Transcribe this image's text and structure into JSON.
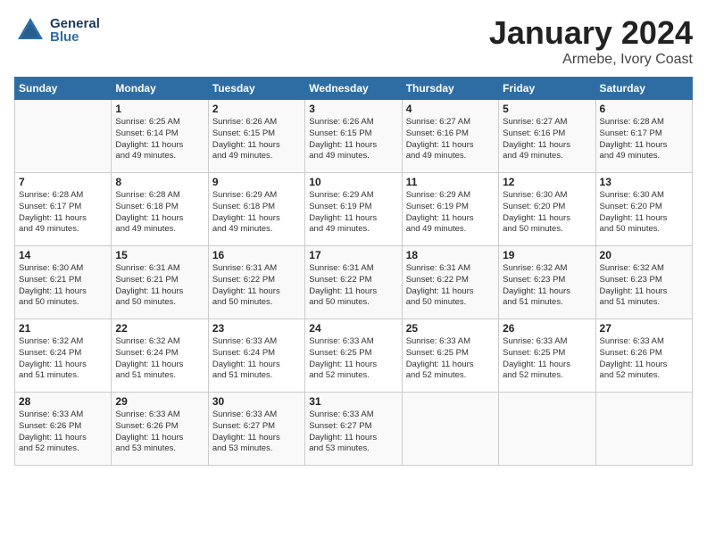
{
  "header": {
    "logo_general": "General",
    "logo_blue": "Blue",
    "month_title": "January 2024",
    "location": "Armebe, Ivory Coast"
  },
  "weekdays": [
    "Sunday",
    "Monday",
    "Tuesday",
    "Wednesday",
    "Thursday",
    "Friday",
    "Saturday"
  ],
  "weeks": [
    [
      {
        "day": "",
        "info": ""
      },
      {
        "day": "1",
        "info": "Sunrise: 6:25 AM\nSunset: 6:14 PM\nDaylight: 11 hours\nand 49 minutes."
      },
      {
        "day": "2",
        "info": "Sunrise: 6:26 AM\nSunset: 6:15 PM\nDaylight: 11 hours\nand 49 minutes."
      },
      {
        "day": "3",
        "info": "Sunrise: 6:26 AM\nSunset: 6:15 PM\nDaylight: 11 hours\nand 49 minutes."
      },
      {
        "day": "4",
        "info": "Sunrise: 6:27 AM\nSunset: 6:16 PM\nDaylight: 11 hours\nand 49 minutes."
      },
      {
        "day": "5",
        "info": "Sunrise: 6:27 AM\nSunset: 6:16 PM\nDaylight: 11 hours\nand 49 minutes."
      },
      {
        "day": "6",
        "info": "Sunrise: 6:28 AM\nSunset: 6:17 PM\nDaylight: 11 hours\nand 49 minutes."
      }
    ],
    [
      {
        "day": "7",
        "info": "Sunrise: 6:28 AM\nSunset: 6:17 PM\nDaylight: 11 hours\nand 49 minutes."
      },
      {
        "day": "8",
        "info": "Sunrise: 6:28 AM\nSunset: 6:18 PM\nDaylight: 11 hours\nand 49 minutes."
      },
      {
        "day": "9",
        "info": "Sunrise: 6:29 AM\nSunset: 6:18 PM\nDaylight: 11 hours\nand 49 minutes."
      },
      {
        "day": "10",
        "info": "Sunrise: 6:29 AM\nSunset: 6:19 PM\nDaylight: 11 hours\nand 49 minutes."
      },
      {
        "day": "11",
        "info": "Sunrise: 6:29 AM\nSunset: 6:19 PM\nDaylight: 11 hours\nand 49 minutes."
      },
      {
        "day": "12",
        "info": "Sunrise: 6:30 AM\nSunset: 6:20 PM\nDaylight: 11 hours\nand 50 minutes."
      },
      {
        "day": "13",
        "info": "Sunrise: 6:30 AM\nSunset: 6:20 PM\nDaylight: 11 hours\nand 50 minutes."
      }
    ],
    [
      {
        "day": "14",
        "info": "Sunrise: 6:30 AM\nSunset: 6:21 PM\nDaylight: 11 hours\nand 50 minutes."
      },
      {
        "day": "15",
        "info": "Sunrise: 6:31 AM\nSunset: 6:21 PM\nDaylight: 11 hours\nand 50 minutes."
      },
      {
        "day": "16",
        "info": "Sunrise: 6:31 AM\nSunset: 6:22 PM\nDaylight: 11 hours\nand 50 minutes."
      },
      {
        "day": "17",
        "info": "Sunrise: 6:31 AM\nSunset: 6:22 PM\nDaylight: 11 hours\nand 50 minutes."
      },
      {
        "day": "18",
        "info": "Sunrise: 6:31 AM\nSunset: 6:22 PM\nDaylight: 11 hours\nand 50 minutes."
      },
      {
        "day": "19",
        "info": "Sunrise: 6:32 AM\nSunset: 6:23 PM\nDaylight: 11 hours\nand 51 minutes."
      },
      {
        "day": "20",
        "info": "Sunrise: 6:32 AM\nSunset: 6:23 PM\nDaylight: 11 hours\nand 51 minutes."
      }
    ],
    [
      {
        "day": "21",
        "info": "Sunrise: 6:32 AM\nSunset: 6:24 PM\nDaylight: 11 hours\nand 51 minutes."
      },
      {
        "day": "22",
        "info": "Sunrise: 6:32 AM\nSunset: 6:24 PM\nDaylight: 11 hours\nand 51 minutes."
      },
      {
        "day": "23",
        "info": "Sunrise: 6:33 AM\nSunset: 6:24 PM\nDaylight: 11 hours\nand 51 minutes."
      },
      {
        "day": "24",
        "info": "Sunrise: 6:33 AM\nSunset: 6:25 PM\nDaylight: 11 hours\nand 52 minutes."
      },
      {
        "day": "25",
        "info": "Sunrise: 6:33 AM\nSunset: 6:25 PM\nDaylight: 11 hours\nand 52 minutes."
      },
      {
        "day": "26",
        "info": "Sunrise: 6:33 AM\nSunset: 6:25 PM\nDaylight: 11 hours\nand 52 minutes."
      },
      {
        "day": "27",
        "info": "Sunrise: 6:33 AM\nSunset: 6:26 PM\nDaylight: 11 hours\nand 52 minutes."
      }
    ],
    [
      {
        "day": "28",
        "info": "Sunrise: 6:33 AM\nSunset: 6:26 PM\nDaylight: 11 hours\nand 52 minutes."
      },
      {
        "day": "29",
        "info": "Sunrise: 6:33 AM\nSunset: 6:26 PM\nDaylight: 11 hours\nand 53 minutes."
      },
      {
        "day": "30",
        "info": "Sunrise: 6:33 AM\nSunset: 6:27 PM\nDaylight: 11 hours\nand 53 minutes."
      },
      {
        "day": "31",
        "info": "Sunrise: 6:33 AM\nSunset: 6:27 PM\nDaylight: 11 hours\nand 53 minutes."
      },
      {
        "day": "",
        "info": ""
      },
      {
        "day": "",
        "info": ""
      },
      {
        "day": "",
        "info": ""
      }
    ]
  ]
}
